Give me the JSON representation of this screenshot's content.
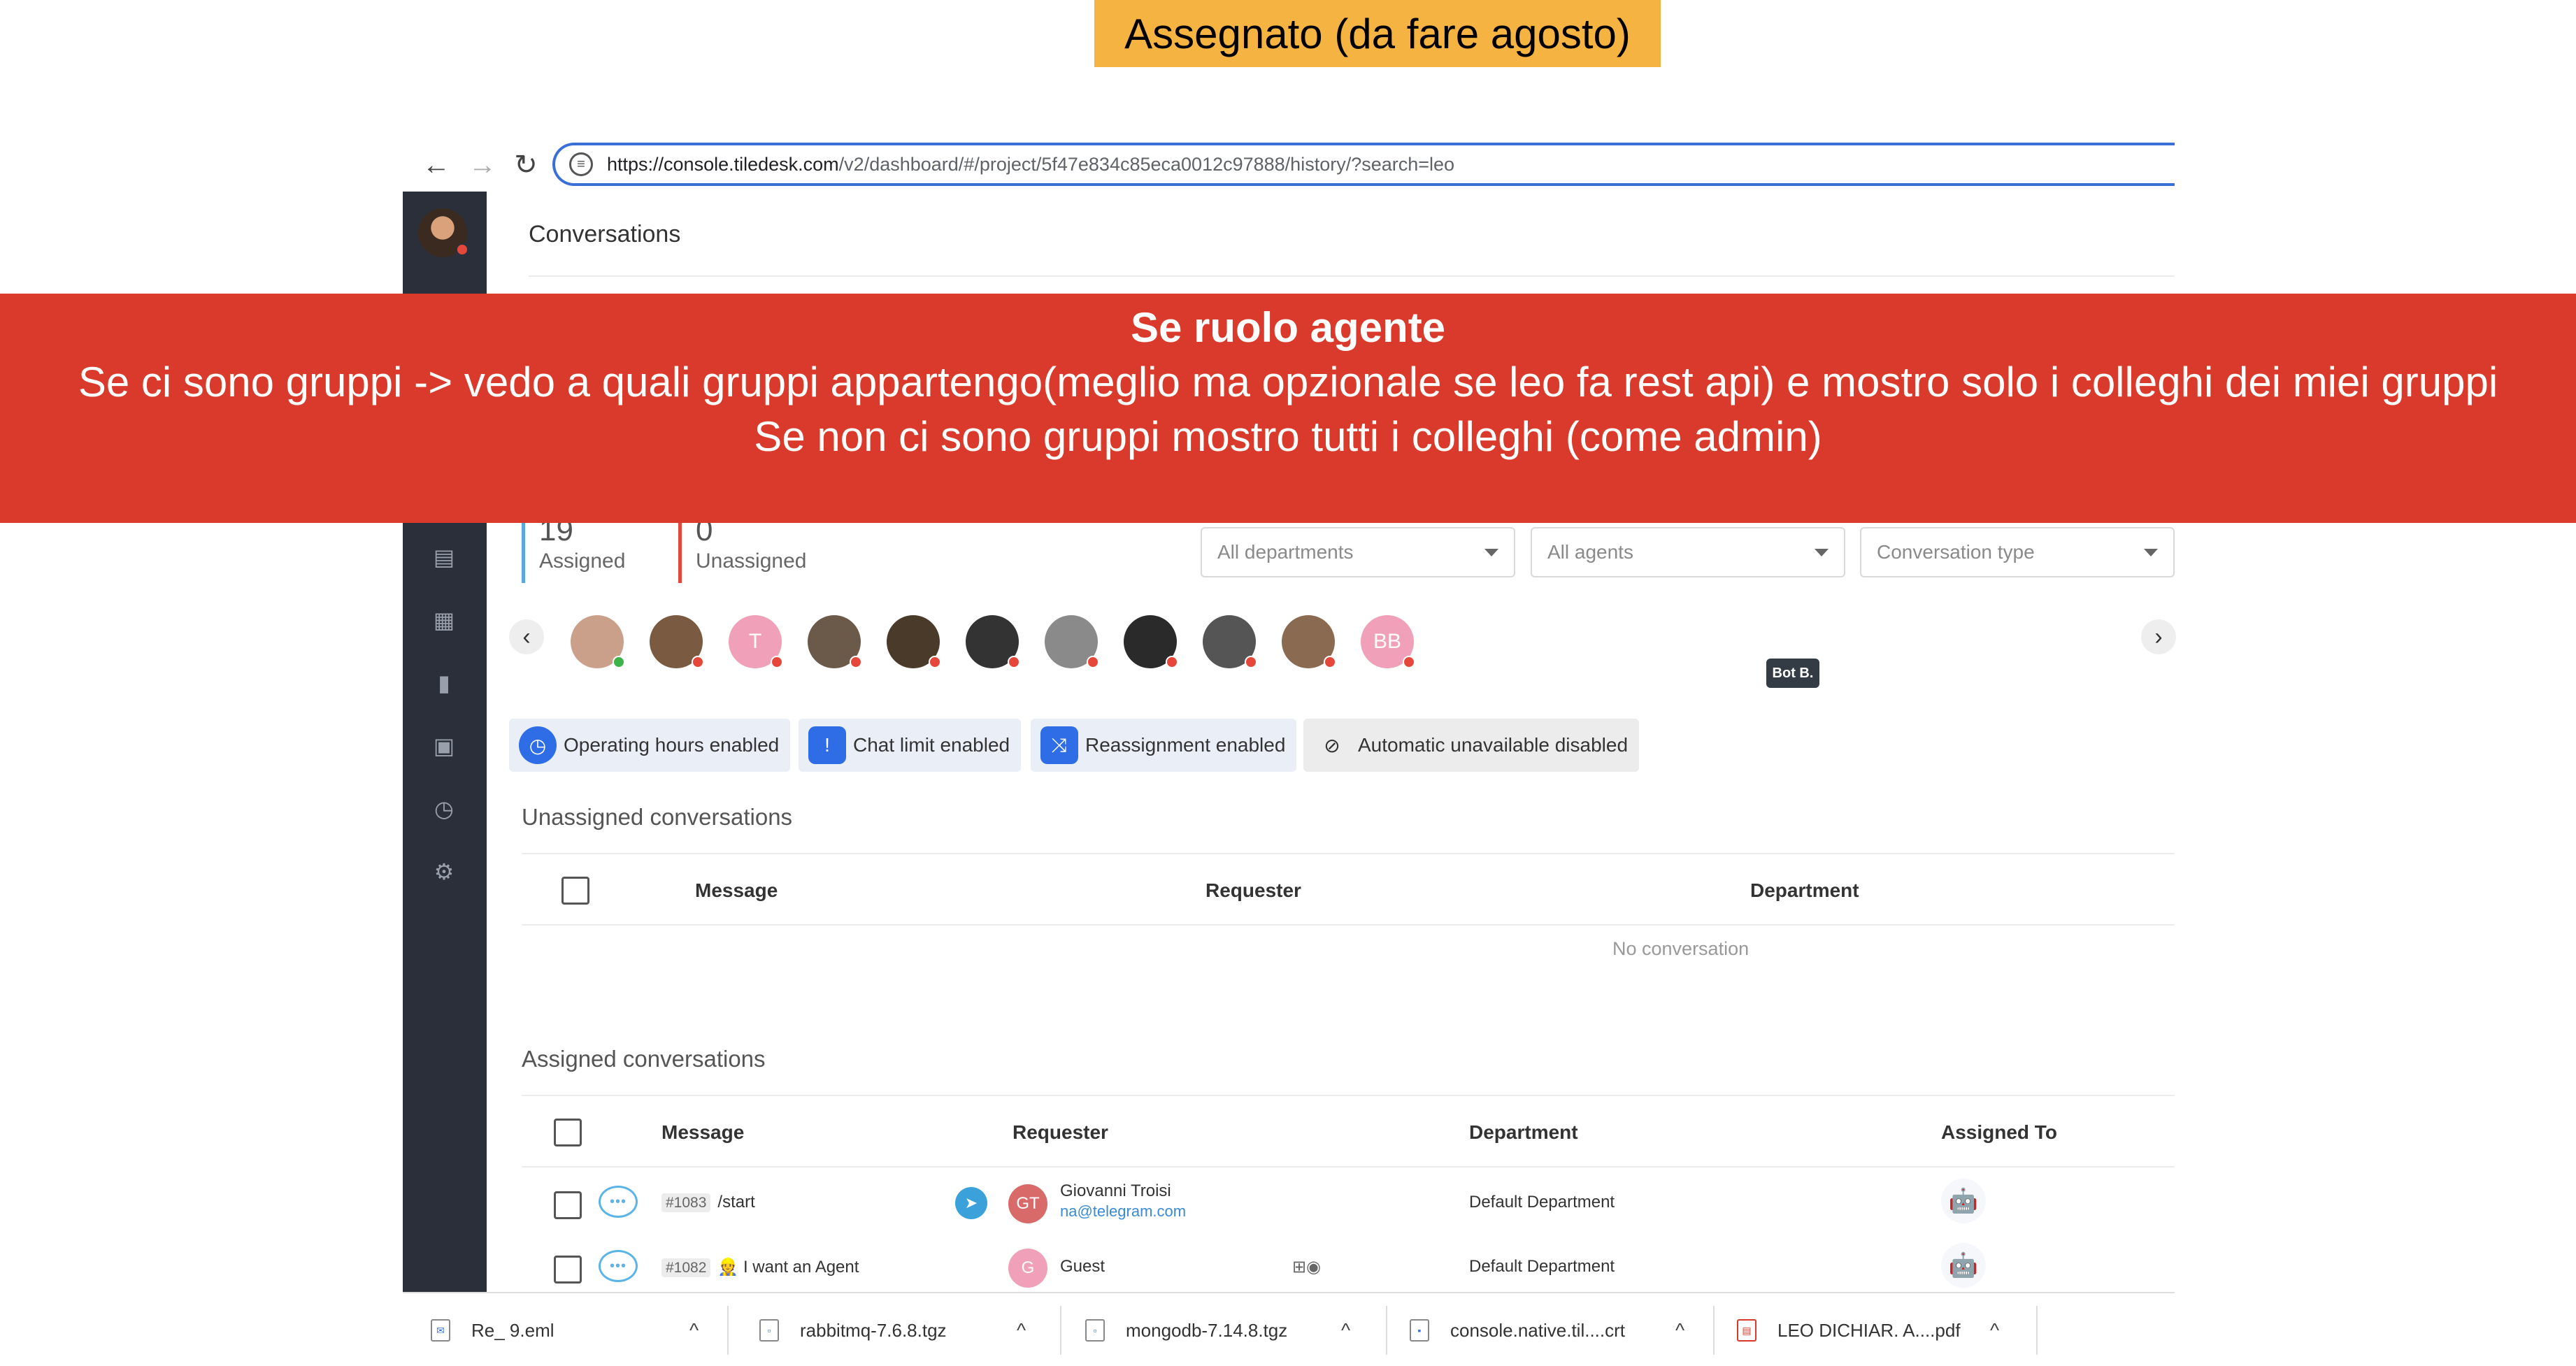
{
  "note": {
    "text": "Assegnato (da fare agosto)",
    "bg": "#f5b342"
  },
  "browser": {
    "url_host": "https://console.tiledesk.com",
    "url_path": "/v2/dashboard/#/project/5f47e834c85eca0012c97888/history/?search=leo",
    "icons": [
      "back-icon",
      "forward-icon",
      "reload-icon",
      "site-info-icon"
    ]
  },
  "app": {
    "title": "Conversations",
    "stats": [
      {
        "num": "19",
        "label": "Assigned",
        "color": "#5aa8e0"
      },
      {
        "num": "0",
        "label": "Unassigned",
        "color": "#e5483a"
      }
    ],
    "filters": [
      {
        "placeholder": "All departments"
      },
      {
        "placeholder": "All agents"
      },
      {
        "placeholder": "Conversation type"
      }
    ],
    "agents": [
      {
        "initials": "",
        "bg": "#caa08a",
        "status": "#3cb44b"
      },
      {
        "initials": "",
        "bg": "#7a5a40",
        "status": "#e5483a"
      },
      {
        "initials": "T",
        "bg": "#f0a0b8",
        "status": "#e5483a"
      },
      {
        "initials": "",
        "bg": "#6b5a4a",
        "status": "#e5483a"
      },
      {
        "initials": "",
        "bg": "#4a3a2a",
        "status": "#e5483a"
      },
      {
        "initials": "",
        "bg": "#333333",
        "status": "#e5483a"
      },
      {
        "initials": "",
        "bg": "#8a8a8a",
        "status": "#e5483a"
      },
      {
        "initials": "",
        "bg": "#2a2a2a",
        "status": "#e5483a"
      },
      {
        "initials": "",
        "bg": "#555555",
        "status": "#e5483a"
      },
      {
        "initials": "",
        "bg": "#8a6a50",
        "status": "#e5483a"
      },
      {
        "initials": "BB",
        "bg": "#f0a0b8",
        "status": "#e5483a"
      }
    ],
    "bot_tooltip": "Bot B.",
    "pills": [
      {
        "label": "Operating hours enabled",
        "icon": "clock-icon",
        "glyph": "◷"
      },
      {
        "label": "Chat limit enabled",
        "icon": "chat-limit-icon",
        "glyph": "!"
      },
      {
        "label": "Reassignment enabled",
        "icon": "reassign-icon",
        "glyph": "⤨"
      },
      {
        "label": "Automatic unavailable disabled",
        "icon": "person-off-icon",
        "glyph": "⊘"
      }
    ],
    "unassigned": {
      "title": "Unassigned conversations",
      "headers": [
        "Message",
        "Requester",
        "Department"
      ],
      "empty": "No conversation"
    },
    "assigned": {
      "title": "Assigned conversations",
      "headers": [
        "Message",
        "Requester",
        "Department",
        "Assigned To"
      ],
      "rows": [
        {
          "ticket": "#1083",
          "message": "/start",
          "req_initials": "GT",
          "req_name": "Giovanni Troisi",
          "req_email": "na@telegram.com",
          "department": "Default Department",
          "channel": "telegram"
        },
        {
          "ticket": "#1082",
          "message": "👷 I want an Agent",
          "req_initials": "G",
          "req_name": "Guest",
          "req_email": "",
          "department": "Default Department",
          "channel": "web"
        }
      ]
    }
  },
  "overlay": {
    "heading": "Se ruolo agente",
    "line1": "Se ci sono gruppi -> vedo a quali gruppi appartengo(meglio ma opzionale se leo fa rest api) e mostro solo i colleghi dei miei gruppi",
    "line2": "Se non ci sono gruppi mostro tutti i colleghi (come admin)",
    "bg": "#d93a2b"
  },
  "downloads": [
    {
      "name": "Re_ 9.eml",
      "type": "eml"
    },
    {
      "name": "rabbitmq-7.6.8.tgz",
      "type": "tgz"
    },
    {
      "name": "mongodb-7.14.8.tgz",
      "type": "tgz"
    },
    {
      "name": "console.native.til....crt",
      "type": "crt"
    },
    {
      "name": "LEO DICHIAR. A....pdf",
      "type": "pdf"
    }
  ]
}
